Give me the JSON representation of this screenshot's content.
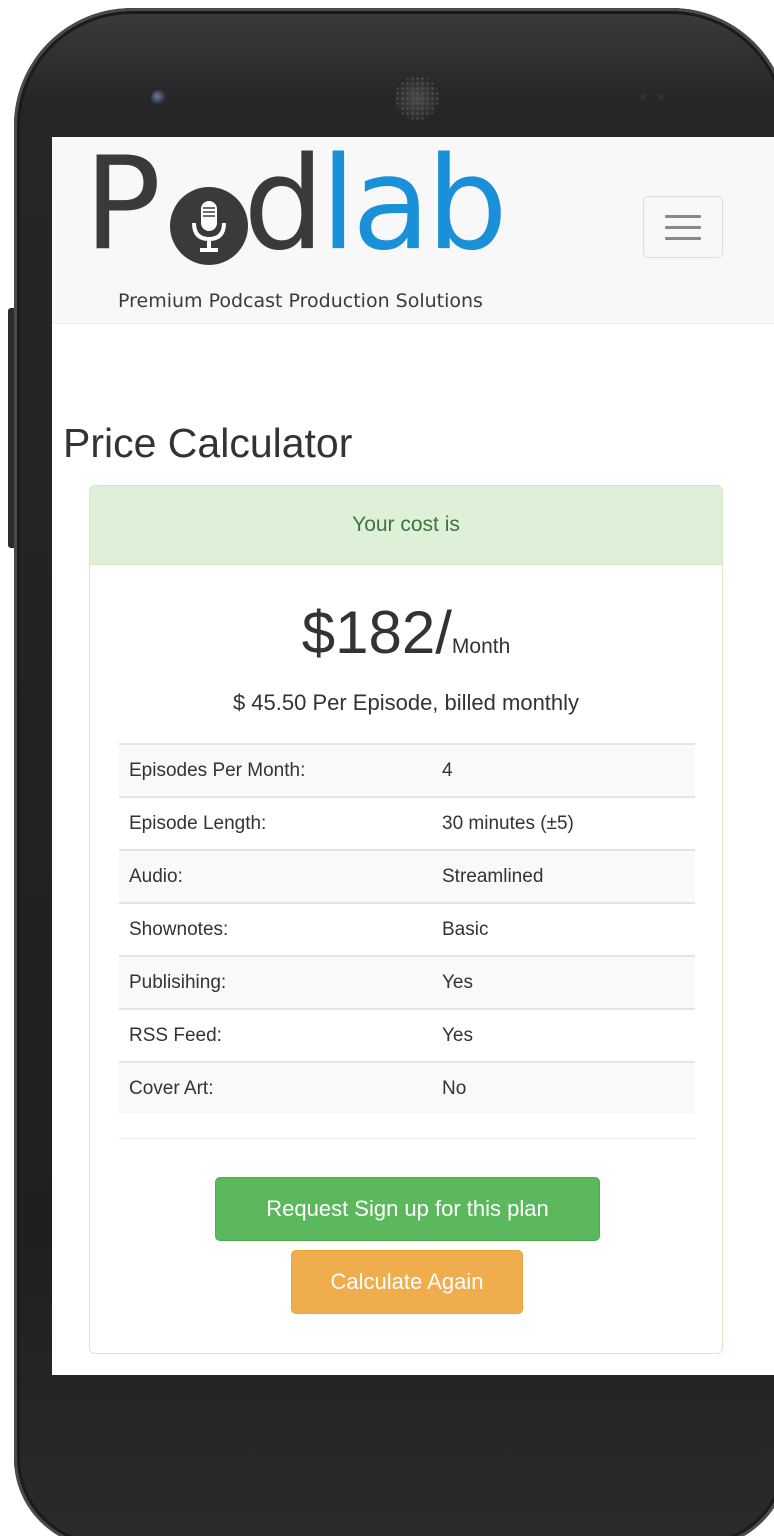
{
  "brand": {
    "logo_part1": "P",
    "logo_part2": "d",
    "logo_part3": "lab",
    "tagline": "Premium Podcast Production Solutions",
    "dark_color": "#3a3a3a",
    "blue_color": "#1a90d9"
  },
  "nav": {
    "menu_icon": "hamburger-menu-icon"
  },
  "page": {
    "title": "Price Calculator"
  },
  "result": {
    "heading": "Your cost is",
    "price": "$182/",
    "price_unit": "Month",
    "per_episode": "$ 45.50 Per Episode, billed monthly"
  },
  "details": [
    {
      "label": "Episodes Per Month:",
      "value": "4"
    },
    {
      "label": "Episode Length:",
      "value": "30 minutes (±5)"
    },
    {
      "label": "Audio:",
      "value": "Streamlined"
    },
    {
      "label": "Shownotes:",
      "value": "Basic"
    },
    {
      "label": "Publisihing:",
      "value": "Yes"
    },
    {
      "label": "RSS Feed:",
      "value": "Yes"
    },
    {
      "label": "Cover Art:",
      "value": "No"
    }
  ],
  "actions": {
    "signup_label": "Request Sign up for this plan",
    "recalculate_label": "Calculate Again"
  },
  "colors": {
    "success": "#5cb85c",
    "warning": "#f0ad4e",
    "panel_heading_bg": "#dff0d8",
    "panel_heading_text": "#3c763d"
  }
}
